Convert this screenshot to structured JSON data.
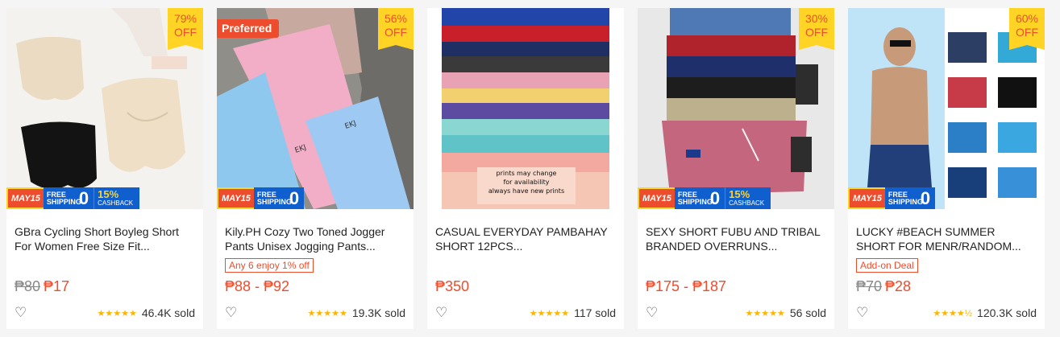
{
  "colors": {
    "accent": "#ee4d2d",
    "discount_bg": "#ffd424",
    "star": "#ffb400",
    "promo_blue": "#0f5fcf"
  },
  "promo": {
    "may": "MAY15",
    "free_shipping": "FREE SHIPPING",
    "zero": "0",
    "cashback_pct": "15%",
    "cashback_label": "CASHBACK"
  },
  "products": [
    {
      "name": "GBra Cycling Short Boyleg Short For Women Free Size Fit...",
      "discount_pct": "79%",
      "discount_label": "OFF",
      "preferred": "",
      "tag": "",
      "price_original": "₱80",
      "price": "₱17",
      "stars": "★★★★★",
      "rating": 5,
      "sold": "46.4K sold",
      "has_cashback": true
    },
    {
      "name": "Kily.PH Cozy Two Toned Jogger Pants Unisex Jogging Pants...",
      "discount_pct": "56%",
      "discount_label": "OFF",
      "preferred": "Preferred",
      "tag": "Any 6 enjoy 1% off",
      "price_original": "",
      "price": "₱88 - ₱92",
      "stars": "★★★★★",
      "rating": 5,
      "sold": "19.3K sold",
      "has_cashback": false
    },
    {
      "name": "CASUAL EVERYDAY PAMBAHAY SHORT 12PCS...",
      "discount_pct": "",
      "discount_label": "",
      "preferred": "",
      "tag": "",
      "price_original": "",
      "price": "₱350",
      "stars": "★★★★★",
      "rating": 5,
      "sold": "117 sold",
      "has_cashback": false,
      "image_text": [
        "prints may change",
        "for availability",
        "always have new prints"
      ]
    },
    {
      "name": "SEXY SHORT FUBU AND TRIBAL BRANDED OVERRUNS...",
      "discount_pct": "30%",
      "discount_label": "OFF",
      "preferred": "",
      "tag": "",
      "price_original": "",
      "price": "₱175 - ₱187",
      "stars": "★★★★★",
      "rating": 5,
      "sold": "56 sold",
      "has_cashback": true
    },
    {
      "name": "LUCKY #BEACH SUMMER SHORT FOR MENR/RANDOM...",
      "discount_pct": "60%",
      "discount_label": "OFF",
      "preferred": "",
      "tag": "Add-on Deal",
      "price_original": "₱70",
      "price": "₱28",
      "stars": "★★★★½",
      "rating": 4.5,
      "sold": "120.3K sold",
      "has_cashback": false
    }
  ]
}
